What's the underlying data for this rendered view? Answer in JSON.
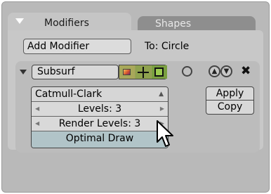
{
  "tabs": {
    "modifiers_label": "Modifiers",
    "shapes_label": "Shapes"
  },
  "panel": {
    "add_modifier_label": "Add Modifier",
    "target_label": "To: Circle"
  },
  "modifier": {
    "name": "Subsurf",
    "subdivision_type": "Catmull-Clark",
    "levels_label": "Levels: 3",
    "render_levels_label": "Render Levels: 3",
    "optimal_draw_label": "Optimal Draw",
    "apply_label": "Apply",
    "copy_label": "Copy"
  },
  "icons": {
    "tab_toggle": "triangle-down-icon",
    "expand": "triangle-down-icon",
    "render": "render-icon",
    "realtime": "plus-icon",
    "editmode_cage": "edit-cage-icon",
    "cage": "circle-icon",
    "move_up": "arrow-up-circle-icon",
    "move_down": "arrow-down-circle-icon",
    "close": "close-icon"
  },
  "colors": {
    "background": "#b9b9b9",
    "panel": "#c8c8c8",
    "active_tab": "#c5c5c5",
    "inactive_tab": "#8e8e8e",
    "optimal_draw_active": "#b1c4c8",
    "icon_group": "#9aa05a"
  }
}
